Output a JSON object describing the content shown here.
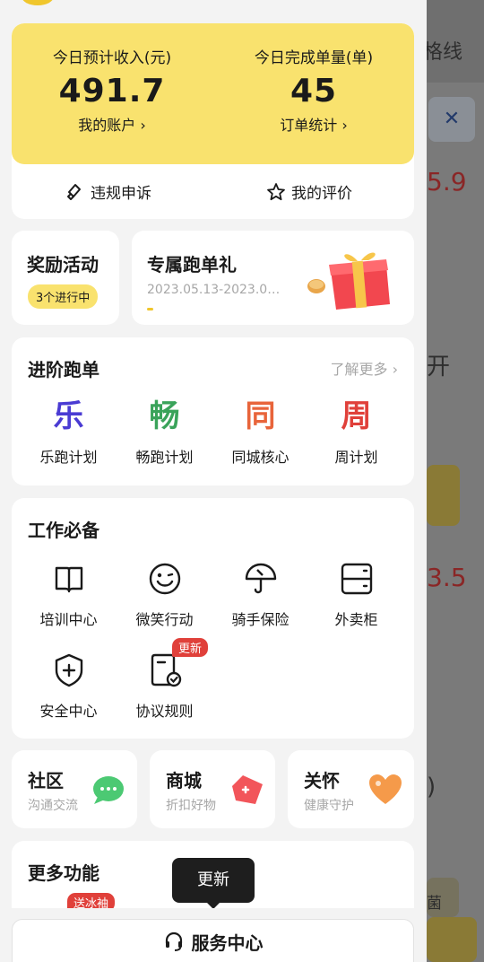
{
  "background": {
    "route_partial": "路线",
    "header_fragment": "格线",
    "close_glyph": "✕",
    "amount1": "5.9",
    "char1": "开",
    "amount2": "3.5",
    "paren": ")",
    "char2": "菌"
  },
  "income": {
    "today_income_label": "今日预计收入(元)",
    "today_income_value": "491.7",
    "account_link": "我的账户 ›",
    "orders_label": "今日完成单量(单)",
    "orders_value": "45",
    "order_stats_link": "订单统计 ›",
    "complaint_label": "违规申诉",
    "rating_label": "我的评价"
  },
  "rewards": {
    "title": "奖励活动",
    "badge": "3个进行中",
    "promo_title": "专属跑单礼",
    "promo_dates": "2023.05.13-2023.0…"
  },
  "advance": {
    "title": "进阶跑单",
    "more": "了解更多 ›",
    "items": [
      {
        "char": "乐",
        "label": "乐跑计划",
        "color": "#4a3bd3"
      },
      {
        "char": "畅",
        "label": "畅跑计划",
        "color": "#3aa35a"
      },
      {
        "char": "同",
        "label": "同城核心",
        "color": "#e8643a"
      },
      {
        "char": "周",
        "label": "周计划",
        "color": "#e0403a"
      }
    ]
  },
  "work": {
    "title": "工作必备",
    "items": [
      {
        "label": "培训中心",
        "icon": "book-icon"
      },
      {
        "label": "微笑行动",
        "icon": "smile-icon"
      },
      {
        "label": "骑手保险",
        "icon": "umbrella-icon"
      },
      {
        "label": "外卖柜",
        "icon": "locker-icon"
      },
      {
        "label": "安全中心",
        "icon": "shield-icon"
      },
      {
        "label": "协议规则",
        "icon": "agreement-icon"
      }
    ],
    "update_badge": "更新"
  },
  "mini": {
    "community_title": "社区",
    "community_desc": "沟通交流",
    "mall_title": "商城",
    "mall_desc": "折扣好物",
    "care_title": "关怀",
    "care_desc": "健康守护"
  },
  "more_functions": {
    "title": "更多功能",
    "ice_badge": "送冰袖"
  },
  "tooltip": "更新",
  "service_center": "服务中心",
  "colors": {
    "accent_yellow": "#f9e26e",
    "badge_red": "#e0403a"
  }
}
